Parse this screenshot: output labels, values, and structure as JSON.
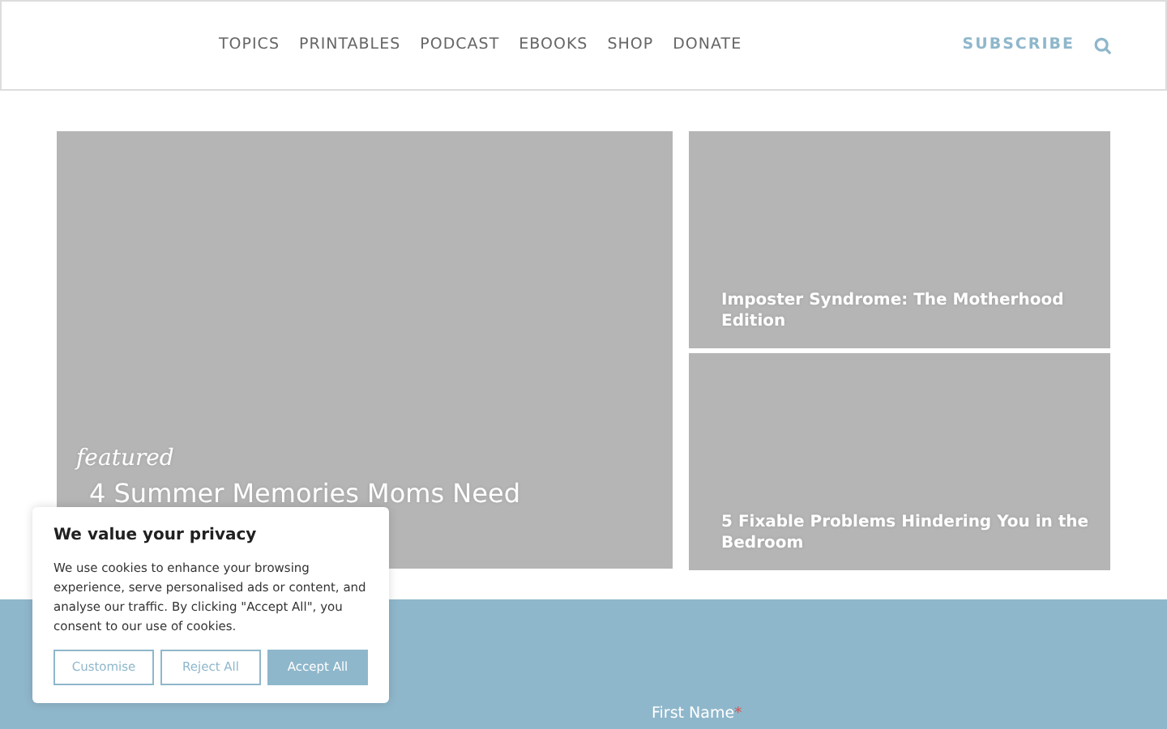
{
  "nav": {
    "items": [
      "TOPICS",
      "PRINTABLES",
      "PODCAST",
      "EBOOKS",
      "SHOP",
      "DONATE"
    ],
    "subscribe": "SUBSCRIBE"
  },
  "featured": {
    "tag": "featured",
    "title": "4 Summer Memories Moms Need"
  },
  "posts": [
    {
      "title": "Imposter Syndrome: The Motherhood Edition"
    },
    {
      "title": "5 Fixable Problems Hindering You in the Bedroom"
    }
  ],
  "signup": {
    "label": "First Name",
    "required": "*"
  },
  "cookie": {
    "title": "We value your privacy",
    "text": "We use cookies to enhance your browsing experience, serve personalised ads or content, and analyse our traffic. By clicking \"Accept All\", you consent to our use of cookies.",
    "buttons": [
      {
        "label": "Customise",
        "kind": "outline"
      },
      {
        "label": "Reject All",
        "kind": "outline"
      },
      {
        "label": "Accept All",
        "kind": "primary"
      }
    ]
  }
}
